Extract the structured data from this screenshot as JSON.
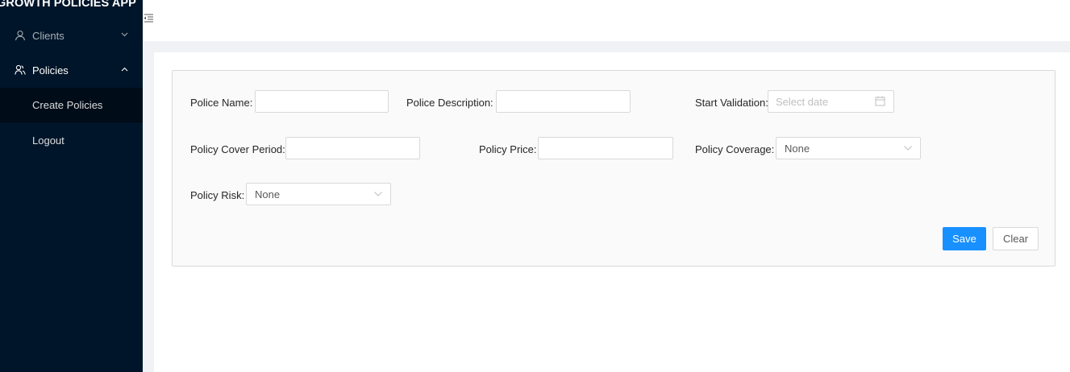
{
  "app": {
    "title": "GROWTH POLICIES APP"
  },
  "sidebar": {
    "items": [
      {
        "label": "Clients",
        "icon": "user-icon"
      },
      {
        "label": "Policies",
        "icon": "team-icon"
      },
      {
        "label": "Create Policies"
      },
      {
        "label": "Logout"
      }
    ]
  },
  "form": {
    "police_name": {
      "label": "Police Name",
      "value": ""
    },
    "police_description": {
      "label": "Police Description",
      "value": ""
    },
    "start_validation": {
      "label": "Start Validation",
      "placeholder": "Select date"
    },
    "policy_cover_period": {
      "label": "Policy Cover Period",
      "value": ""
    },
    "policy_price": {
      "label": "Policy Price",
      "value": ""
    },
    "policy_coverage": {
      "label": "Policy Coverage",
      "value": "None"
    },
    "policy_risk": {
      "label": "Policy Risk",
      "value": "None"
    },
    "save_label": "Save",
    "clear_label": "Clear"
  },
  "colors": {
    "sidebar_bg": "#001529",
    "submenu_bg": "#000c17",
    "primary": "#1890ff",
    "page_bg": "#f0f2f5"
  }
}
